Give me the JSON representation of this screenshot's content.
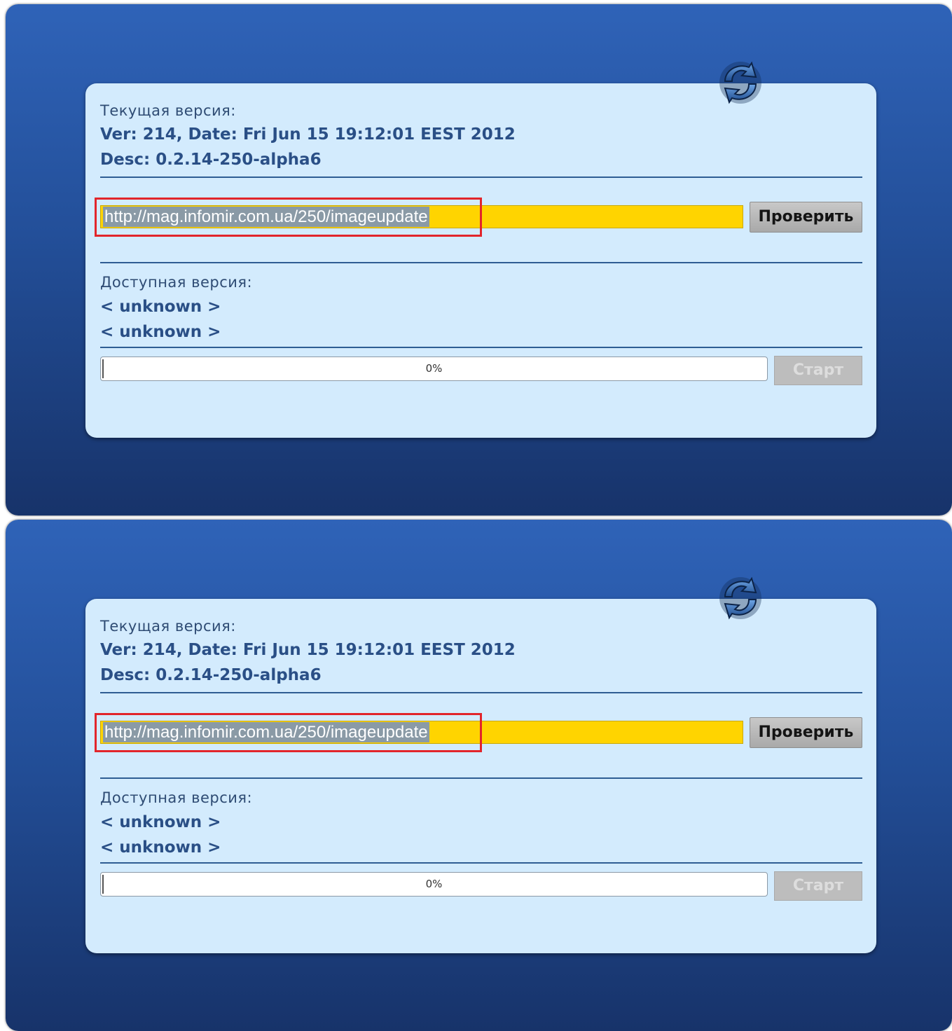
{
  "screens": [
    {
      "current_version_label": "Текущая версия:",
      "current_ver_line": "Ver: 214, Date: Fri Jun 15 19:12:01 EEST 2012",
      "current_desc_line": "Desc: 0.2.14-250-alpha6",
      "url_value": "http://mag.infomir.com.ua/250/imageupdate",
      "check_button_label": "Проверить",
      "available_version_label": "Доступная версия:",
      "available_line_1": "< unknown >",
      "available_line_2": "< unknown >",
      "progress_text": "0%",
      "progress_value": 0,
      "start_button_label": "Старт"
    },
    {
      "current_version_label": "Текущая версия:",
      "current_ver_line": "Ver: 214, Date: Fri Jun 15 19:12:01 EEST 2012",
      "current_desc_line": "Desc: 0.2.14-250-alpha6",
      "url_value": "http://mag.infomir.com.ua/250/imageupdate",
      "check_button_label": "Проверить",
      "available_version_label": "Доступная версия:",
      "available_line_1": "< unknown >",
      "available_line_2": "< unknown >",
      "progress_text": "0%",
      "progress_value": 0,
      "start_button_label": "Старт"
    }
  ],
  "icons": {
    "sync": "sync-icon"
  },
  "colors": {
    "screen_background": "#2f63b8",
    "panel_background": "#d3ebfd",
    "url_field": "#ffd400",
    "highlight": "#e2252b",
    "text_blue": "#2a4f86"
  }
}
